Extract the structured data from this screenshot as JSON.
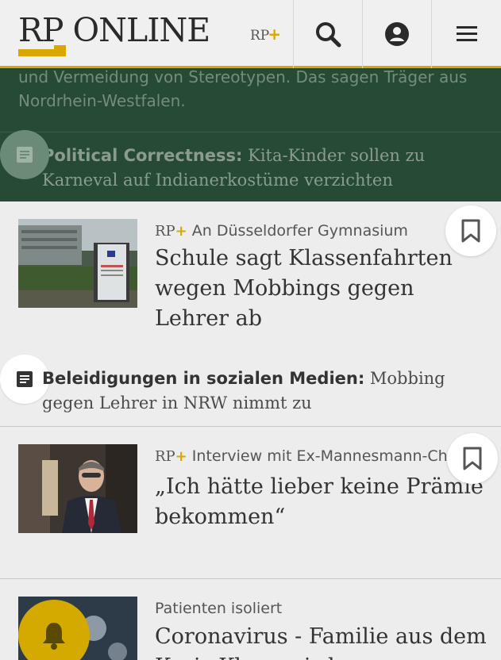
{
  "header": {
    "logo_text": "RP ONLINE",
    "rpplus_label": "RP",
    "rpplus_plus": "+",
    "icons": [
      "search-icon",
      "account-icon",
      "menu-icon"
    ],
    "accent_color": "#d9a700"
  },
  "teaser": {
    "continuation_text": "und Vermeidung von Stereotypen. Das sagen Träger aus Nordrhein-Westfalen.",
    "related_kicker": "Political Correctness:",
    "related_title": " Kita-Kinder sollen zu Karneval auf Indianerkostüme verzichten"
  },
  "articles": [
    {
      "premium": true,
      "premium_label": "RP",
      "premium_plus": "+",
      "kicker": " An Düsseldorfer Gymnasium",
      "title": "Schule sagt Klassenfahrten wegen Mobbings gegen Lehrer ab",
      "related_kicker": "Beleidigungen in sozialen Medien:",
      "related_title": " Mobbing gegen Lehrer in NRW nimmt zu"
    },
    {
      "premium": true,
      "premium_label": "RP",
      "premium_plus": "+",
      "kicker": " Interview mit Ex-Mannesmann-Chef",
      "title": "„Ich hätte lieber keine Prämie bekommen“"
    },
    {
      "premium": false,
      "kicker": "Patienten isoliert",
      "title": "Coronavirus - Familie aus dem Kreis Kleve wird"
    }
  ]
}
